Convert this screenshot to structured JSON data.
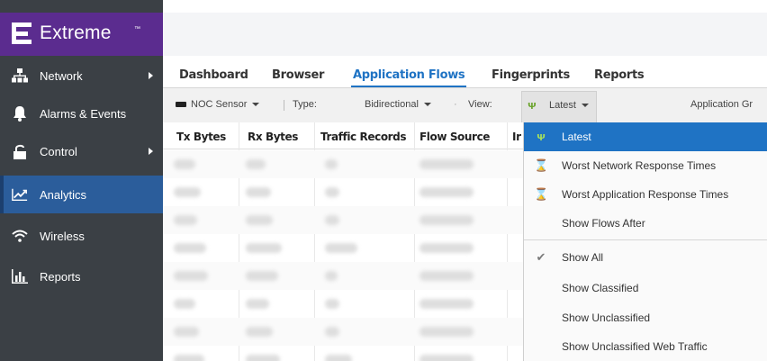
{
  "brand": {
    "name": "Extreme",
    "tm": "™"
  },
  "sidebar": {
    "items": [
      {
        "label": "Network",
        "icon": "network-icon",
        "arrow": true
      },
      {
        "label": "Alarms & Events",
        "icon": "bell-icon",
        "arrow": false
      },
      {
        "label": "Control",
        "icon": "lock-icon",
        "arrow": true
      },
      {
        "label": "Analytics",
        "icon": "analytics-chart-icon",
        "arrow": false,
        "active": true
      },
      {
        "label": "Wireless",
        "icon": "wifi-icon",
        "arrow": false
      },
      {
        "label": "Reports",
        "icon": "bar-chart-icon",
        "arrow": false
      }
    ]
  },
  "tabs": [
    {
      "label": "Dashboard"
    },
    {
      "label": "Browser"
    },
    {
      "label": "Application Flows",
      "active": true
    },
    {
      "label": "Fingerprints"
    },
    {
      "label": "Reports"
    }
  ],
  "toolbar": {
    "sensor": "NOC Sensor",
    "type_label": "Type:",
    "type_value": "Bidirectional",
    "view_label": "View:",
    "view_value": "Latest",
    "app_group": "Application Gr"
  },
  "table": {
    "columns": [
      "Tx Bytes",
      "Rx Bytes",
      "Traffic Records",
      "Flow Source",
      "Ir"
    ]
  },
  "dropdown": {
    "items": [
      {
        "label": "Latest",
        "icon": "latest-icon",
        "selected": true
      },
      {
        "label": "Worst Network Response Times",
        "icon": "hourglass-icon"
      },
      {
        "label": "Worst Application Response Times",
        "icon": "hourglass-icon"
      },
      {
        "label": "Show Flows After",
        "icon": ""
      },
      {
        "label": "Show All",
        "icon": "checkmark-icon"
      },
      {
        "label": "Show Classified",
        "icon": ""
      },
      {
        "label": "Show Unclassified",
        "icon": ""
      },
      {
        "label": "Show Unclassified Web Traffic",
        "icon": ""
      }
    ]
  },
  "colors": {
    "sidebar_bg": "#3b4045",
    "brand_bg": "#5b2c8f",
    "active_nav": "#2b5d9b",
    "accent": "#1f73c4"
  }
}
